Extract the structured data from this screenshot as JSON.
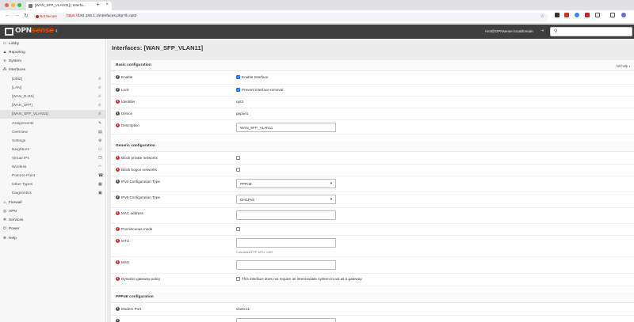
{
  "browser": {
    "tab_title": "[WAN_SFP_VLAN11] | Interfa...",
    "new_tab_symbol": "+",
    "not_secure": "Not Secure",
    "url_scheme": "https://",
    "url_rest": "192.168.1.1/interfaces.php?if=opt3",
    "colors": {
      "close": "#ff5f57",
      "minimize": "#febc2e",
      "maximize": "#28c840"
    }
  },
  "header": {
    "logo_text": "OPN",
    "logo_accent": "sense",
    "user": "root@OPNsense.localdomain",
    "accent_color": "#d94f00"
  },
  "sidebar": {
    "items": [
      {
        "label": "Lobby",
        "icon": "laptop-icon",
        "glyph": "▭"
      },
      {
        "label": "Reporting",
        "icon": "chart-icon",
        "glyph": "▲"
      },
      {
        "label": "System",
        "icon": "server-icon",
        "glyph": "≡"
      },
      {
        "label": "Interfaces",
        "icon": "sitemap-icon",
        "glyph": "⁂"
      }
    ],
    "sub_items": [
      {
        "label": "[DMZ]",
        "glyph": "⛙"
      },
      {
        "label": "[LAN]",
        "glyph": "⛙"
      },
      {
        "label": "[WAN_RJ45]",
        "glyph": "⛙"
      },
      {
        "label": "[WAN_SFP]",
        "glyph": "⛙"
      },
      {
        "label": "[WAN_SFP_VLAN11]",
        "glyph": "⛙"
      },
      {
        "label": "Assignments",
        "glyph": "✎"
      },
      {
        "label": "Overview",
        "glyph": "▤"
      },
      {
        "label": "Settings",
        "glyph": "⚙"
      },
      {
        "label": "Neighbors",
        "glyph": "⚇"
      },
      {
        "label": "Virtual IPs",
        "glyph": "❐"
      },
      {
        "label": "Wireless",
        "glyph": "◠"
      },
      {
        "label": "Point-to-Point",
        "glyph": "☎"
      },
      {
        "label": "Other Types",
        "glyph": "▦"
      },
      {
        "label": "Diagnostics",
        "glyph": "▣"
      }
    ],
    "bottom_items": [
      {
        "label": "Firewall",
        "icon": "fire-icon",
        "glyph": "♨"
      },
      {
        "label": "VPN",
        "icon": "globe-icon",
        "glyph": "◎"
      },
      {
        "label": "Services",
        "icon": "cog-icon",
        "glyph": "✲"
      },
      {
        "label": "Power",
        "icon": "plug-icon",
        "glyph": "⏻"
      },
      {
        "label": "Help",
        "icon": "support-icon",
        "glyph": "⊕"
      }
    ]
  },
  "page": {
    "title": "Interfaces: [WAN_SFP_VLAN11]",
    "full_help": "full help"
  },
  "basic": {
    "title": "Basic configuration",
    "enable_label": "Enable",
    "enable_text": "Enable Interface",
    "enable_checked": true,
    "lock_label": "Lock",
    "lock_text": "Prevent interface removal",
    "lock_checked": true,
    "identifier_label": "Identifier",
    "identifier_value": "opt3",
    "device_label": "Device",
    "device_value": "pppoe1",
    "description_label": "Description",
    "description_value": "WAN_SFP_VLAN11"
  },
  "generic": {
    "title": "Generic configuration",
    "block_private_label": "Block private networks",
    "block_bogon_label": "Block bogon networks",
    "ipv4_label": "IPv4 Configuration Type",
    "ipv4_value": "PPPoE",
    "ipv6_label": "IPv6 Configuration Type",
    "ipv6_value": "DHCPv6",
    "mac_label": "MAC address",
    "promisc_label": "Promiscuous mode",
    "mtu_label": "MTU",
    "mtu_hint": "Calculated PPP MTU: 1492",
    "mss_label": "MSS",
    "dyn_gw_label": "Dynamic gateway policy",
    "dyn_gw_text": "This interface does not require an intermediate system to act as a gateway"
  },
  "pppoe": {
    "title": "PPPoE configuration",
    "modem_port_label": "Modem Port",
    "modem_port_value": "vlan0.11"
  }
}
